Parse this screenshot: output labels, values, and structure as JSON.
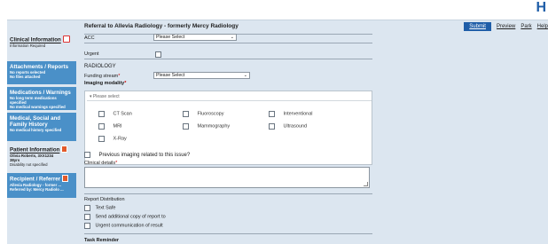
{
  "logo": {
    "text": "H"
  },
  "form": {
    "title": "Referral to Allevia Radiology - formerly Mercy Radiology"
  },
  "toolbar": {
    "submit": "Submit",
    "preview": "Preview",
    "park": "Park",
    "help": "Help"
  },
  "sidebar": {
    "clinical": {
      "title": "Clinical Information",
      "sub": "Information Required"
    },
    "attachments": {
      "title": "Attachments / Reports",
      "sub1": "No reports selected",
      "sub2": "No files attached"
    },
    "medications": {
      "title": "Medications / Warnings",
      "sub1": "No long term medications specified",
      "sub2": "No medical warnings specified"
    },
    "history": {
      "title": "Medical, Social and Family History",
      "sub": "No medical history specified"
    },
    "patient": {
      "title": "Patient Information",
      "sub1": "Olivia Roberts, 3XX1234",
      "sub2": "38yrs",
      "sub3": "Disability not specified"
    },
    "recipient": {
      "title": "Recipient / Referrer",
      "sub1": "Allevia Radiology - former ...",
      "sub2": "Referred by: Mercy Radiolo ..."
    }
  },
  "fields": {
    "acc": {
      "label": "ACC",
      "value": "Please Select"
    },
    "urgent": {
      "label": "Urgent"
    },
    "radiology": {
      "heading": "RADIOLOGY"
    },
    "funding": {
      "label": "Funding stream",
      "value": "Please Select"
    },
    "modality": {
      "label": "Imaging modality",
      "placeholder": "Please select",
      "options": [
        "CT Scan",
        "Fluoroscopy",
        "Interventional",
        "MRI",
        "Mammography",
        "Ultrasound",
        "X-Ray"
      ]
    },
    "previous": {
      "label": "Previous imaging related to this issue?"
    },
    "clinical_details": {
      "label": "Clinical details"
    },
    "report_distribution": {
      "heading": "Report Distribution",
      "options": [
        "Text Safe",
        "Send additional copy of report to",
        "Urgent communication of result"
      ]
    },
    "task_reminder": {
      "heading": "Task Reminder"
    }
  },
  "required_marker": "*"
}
